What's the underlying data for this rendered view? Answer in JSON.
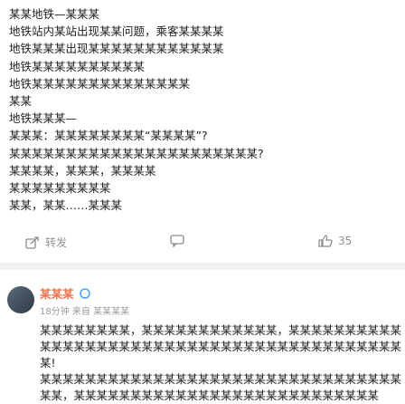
{
  "post": {
    "lines": [
      "某某地铁—某某某",
      "地铁站内某站出现某某问题，乘客某某某某",
      "地铁某某某出现某某某某某某某某某某某某",
      "地铁某某某某某某某某某某",
      "地铁某某某某某某某某某某某某某某",
      "某某",
      "地铁某某某—",
      "某某某：某某某某某某某某“某某某某”?",
      "某某某某某某某某某某某某某某某某某某某某某某?",
      "某某某某，某某某，某某某某",
      "某某某某某某某某某",
      "某某，某某……某某某",
      ""
    ],
    "actions": {
      "share_label": "转发",
      "comment_label": "",
      "like_count": "35"
    }
  },
  "comment": {
    "author": "某某某",
    "meta": "18分钟 来自 某某某某",
    "lines": [
      "某某某某某某某某，某某某某某某某某某某某某，某某某某某某某某某某某",
      "某某某某某某某某某某某某某某某某某某某某某某某某某某某某某某某某",
      "某!",
      "某某某某某某某某某某某某某某某某某某某某某某某某某某某某某某某某",
      "某某，某某某某某某某某某某某某某某某某某某某某某某某某某某某"
    ]
  }
}
